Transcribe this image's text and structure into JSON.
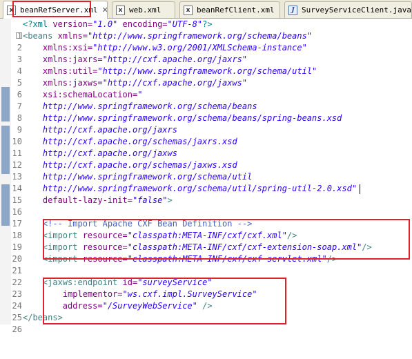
{
  "tabs": [
    {
      "label": "beanRefServer.xml",
      "icon": "xml-file-icon",
      "active": true,
      "close": "✕"
    },
    {
      "label": "web.xml",
      "icon": "xml-file-icon",
      "active": false
    },
    {
      "label": "beanRefClient.xml",
      "icon": "xml-file-icon",
      "active": false
    },
    {
      "label": "SurveyServiceClient.java",
      "icon": "java-file-icon",
      "active": false
    }
  ],
  "highlight_color": "#e0202a",
  "editor": {
    "line_numbers": [
      "1",
      "2",
      "3",
      "4",
      "5",
      "6",
      "7",
      "8",
      "9",
      "10",
      "11",
      "12",
      "13",
      "14",
      "15",
      "16",
      "17",
      "18",
      "19",
      "20",
      "21",
      "22",
      "23",
      "24",
      "25",
      "26"
    ],
    "lines": [
      [
        "<?xml ",
        "version=",
        "\"1.0\"",
        " encoding=",
        "\"UTF-8\"",
        "?>"
      ],
      [
        "<beans ",
        "xmlns=",
        "\"http://www.springframework.org/schema/beans\""
      ],
      [
        "    ",
        "xmlns:xsi=",
        "\"http://www.w3.org/2001/XMLSchema-instance\""
      ],
      [
        "    ",
        "xmlns:jaxrs=",
        "\"http://cxf.apache.org/jaxrs\""
      ],
      [
        "    ",
        "xmlns:util=",
        "\"http://www.springframework.org/schema/util\""
      ],
      [
        "    ",
        "xmlns:jaxws=",
        "\"http://cxf.apache.org/jaxws\""
      ],
      [
        "    ",
        "xsi:schemaLocation=",
        "\""
      ],
      [
        "    ",
        "http://www.springframework.org/schema/beans"
      ],
      [
        "    ",
        "http://www.springframework.org/schema/beans/spring-beans.xsd"
      ],
      [
        "    ",
        "http://cxf.apache.org/jaxrs"
      ],
      [
        "    ",
        "http://cxf.apache.org/schemas/jaxrs.xsd"
      ],
      [
        "    ",
        "http://cxf.apache.org/jaxws"
      ],
      [
        "    ",
        "http://cxf.apache.org/schemas/jaxws.xsd"
      ],
      [
        "    ",
        "http://www.springframework.org/schema/util"
      ],
      [
        "    ",
        "http://www.springframework.org/schema/util/spring-util-2.0.xsd\""
      ],
      [
        "    ",
        "default-lazy-init=",
        "\"false\"",
        ">"
      ],
      [
        ""
      ],
      [
        "    ",
        "<!-- Import Apache CXF Bean Definition -->"
      ],
      [
        "    ",
        "<import ",
        "resource=",
        "\"classpath:META-INF/cxf/cxf.xml\"",
        "/>"
      ],
      [
        "    ",
        "<import ",
        "resource=",
        "\"classpath:META-INF/cxf/cxf-extension-soap.xml\"",
        "/>"
      ],
      [
        "    ",
        "<import ",
        "resource=",
        "\"classpath:META-INF/cxf/cxf-servlet.xml\"",
        "/>"
      ],
      [
        ""
      ],
      [
        "    ",
        "<jaxws:endpoint ",
        "id=",
        "\"surveyService\""
      ],
      [
        "        ",
        "implementor=",
        "\"ws.cxf.impl.SurveyService\""
      ],
      [
        "        ",
        "address=",
        "\"/SurveyWebService\"",
        " />"
      ],
      [
        "</beans>"
      ]
    ]
  }
}
